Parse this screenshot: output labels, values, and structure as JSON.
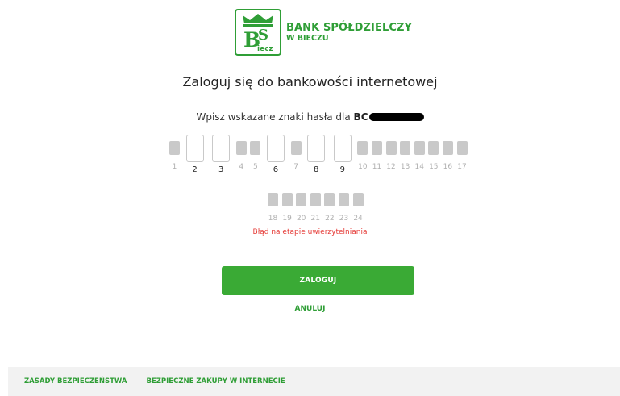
{
  "logo": {
    "line1": "BANK SPÓŁDZIELCZY",
    "line2": "W BIECZU",
    "mark_letters": "BS",
    "mark_sub": "iecz",
    "brand_color": "#2f9e36"
  },
  "title": "Zaloguj się do bankowości internetowej",
  "prompt": {
    "text": "Wpisz wskazane znaki hasła dla ",
    "login_prefix": "BC"
  },
  "password_positions": [
    {
      "n": "1",
      "active": false
    },
    {
      "n": "2",
      "active": true
    },
    {
      "n": "3",
      "active": true
    },
    {
      "n": "4",
      "active": false
    },
    {
      "n": "5",
      "active": false
    },
    {
      "n": "6",
      "active": true
    },
    {
      "n": "7",
      "active": false
    },
    {
      "n": "8",
      "active": true
    },
    {
      "n": "9",
      "active": true
    },
    {
      "n": "10",
      "active": false
    },
    {
      "n": "11",
      "active": false
    },
    {
      "n": "12",
      "active": false
    },
    {
      "n": "13",
      "active": false
    },
    {
      "n": "14",
      "active": false
    },
    {
      "n": "15",
      "active": false
    },
    {
      "n": "16",
      "active": false
    },
    {
      "n": "17",
      "active": false
    },
    {
      "n": "18",
      "active": false
    },
    {
      "n": "19",
      "active": false
    },
    {
      "n": "20",
      "active": false
    },
    {
      "n": "21",
      "active": false
    },
    {
      "n": "22",
      "active": false
    },
    {
      "n": "23",
      "active": false
    },
    {
      "n": "24",
      "active": false
    }
  ],
  "error": "Błąd na etapie uwierzytelniania",
  "buttons": {
    "login": "ZALOGUJ",
    "cancel": "ANULUJ"
  },
  "footer": {
    "links": [
      "ZASADY BEZPIECZEŃSTWA",
      "BEZPIECZNE ZAKUPY W INTERNECIE"
    ]
  },
  "colors": {
    "primary": "#3aaa35",
    "error": "#e53935"
  }
}
